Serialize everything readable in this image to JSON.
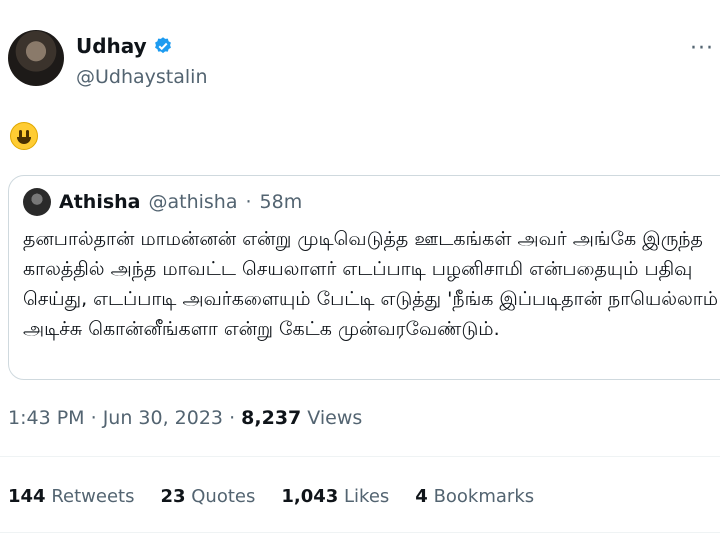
{
  "author": {
    "name": "Udhay",
    "handle": "@Udhaystalin"
  },
  "tweet": {
    "emoji_icon": "grinning-face-emoji"
  },
  "quoted": {
    "name": "Athisha",
    "handle": "@athisha",
    "separator": "·",
    "time": "58m",
    "text": "தனபால்தான் மாமன்னன் என்று முடிவெடுத்த ஊடகங்கள் அவர் அங்கே இருந்த காலத்தில் அந்த மாவட்ட செயலாளர் எடப்பாடி பழனிசாமி என்பதையும் பதிவு செய்து, எடப்பாடி அவர்களையும் பேட்டி எடுத்து 'நீங்க இப்படிதான் நாயெல்லாம் அடிச்சு கொன்னீங்களா என்று கேட்க முன்வரவேண்டும்."
  },
  "meta": {
    "time": "1:43 PM",
    "sep1": " · ",
    "date": "Jun 30, 2023",
    "sep2": " · ",
    "views_count": "8,237",
    "views_label": " Views"
  },
  "stats": [
    {
      "count": "144",
      "label": "Retweets"
    },
    {
      "count": "23",
      "label": "Quotes"
    },
    {
      "count": "1,043",
      "label": "Likes"
    },
    {
      "count": "4",
      "label": "Bookmarks"
    }
  ],
  "colors": {
    "verified": "#1d9bf0",
    "secondary_text": "#536471",
    "border": "#cfd9de"
  }
}
